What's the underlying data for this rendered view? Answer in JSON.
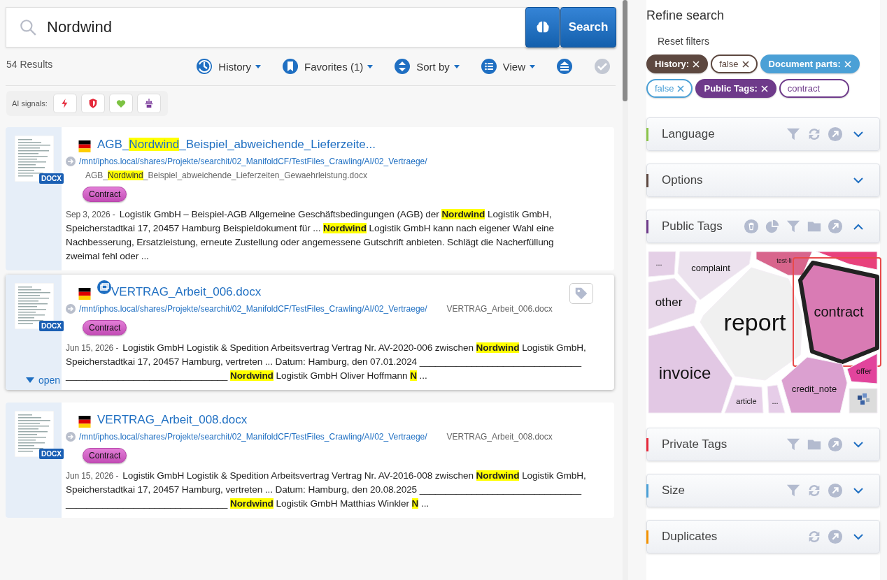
{
  "search": {
    "value": "Nordwind",
    "button": "Search"
  },
  "results_count": "54 Results",
  "toolbar": {
    "menus": [
      {
        "kind": "history",
        "label": "History"
      },
      {
        "kind": "favorites",
        "label": "Favorites (1)"
      },
      {
        "kind": "sort",
        "label": "Sort by"
      },
      {
        "kind": "view",
        "label": "View"
      }
    ],
    "icon_buttons": [
      {
        "kind": "collapse",
        "disabled": false
      },
      {
        "kind": "select",
        "disabled": true
      }
    ]
  },
  "ai_signals": {
    "label": "AI signals:",
    "items": [
      {
        "kind": "bolt"
      },
      {
        "kind": "shield"
      },
      {
        "kind": "heart"
      },
      {
        "kind": "robot"
      }
    ]
  },
  "results": [
    {
      "title": "AGB_**Nordwind**_Beispiel_abweichende_Lieferzeite...",
      "preview_icon": false,
      "tag_button": false,
      "file_type": "DOCX",
      "path": "/mnt/iphos.local/shares/Projekte/searchit/02_ManifoldCF/TestFiles_Crawling/AI/02_Vertraege/",
      "filename": "AGB_**Nordwind**_Beispiel_abweichende_Lieferzeiten_Gewaehrleistung.docx",
      "tag": "Contract",
      "date": "Sep 3, 2026 -",
      "snippet": "Logistik GmbH – Beispiel-AGB Allgemeine Geschäftsbedingungen (AGB) der **Nordwind** Logistik GmbH, Speicherstadtkai 17, 20457 Hamburg Beispieldokument für ... **Nordwind** Logistik GmbH kann nach eigener Wahl eine Nachbesserung, Ersatzleistung, erneute Zustellung oder angemessene Gutschrift anbieten. Schlägt die Nacherfüllung zweimal fehl oder ..."
    },
    {
      "title": "VERTRAG_Arbeit_006.docx",
      "preview_icon": true,
      "tag_button": true,
      "open_toggle": "open",
      "file_type": "DOCX",
      "path": "/mnt/iphos.local/shares/Projekte/searchit/02_ManifoldCF/TestFiles_Crawling/AI/02_Vertraege/",
      "filename": "VERTRAG_Arbeit_006.docx",
      "tag": "Contract",
      "date": "Jun 15, 2026 -",
      "snippet": "Logistik GmbH Logistik & Spedition Arbeitsvertrag Vertrag Nr. AV-2020-006 zwischen **Nordwind** Logistik GmbH, Speicherstadtkai 17, 20457 Hamburg, vertreten ... Datum: Hamburg, den 07.01.2024 _______________________________ _______________________________ **Nordwind** Logistik GmbH Oliver Hoffmann **N** ..."
    },
    {
      "title": "VERTRAG_Arbeit_008.docx",
      "preview_icon": false,
      "tag_button": false,
      "file_type": "DOCX",
      "path": "/mnt/iphos.local/shares/Projekte/searchit/02_ManifoldCF/TestFiles_Crawling/AI/02_Vertraege/",
      "filename": "VERTRAG_Arbeit_008.docx",
      "tag": "Contract",
      "date": "Jun 15, 2026 -",
      "snippet": "Logistik GmbH Logistik & Spedition Arbeitsvertrag Vertrag Nr. AV-2016-008 zwischen **Nordwind** Logistik GmbH, Speicherstadtkai 17, 20457 Hamburg, vertreten ... Datum: Hamburg, den 20.08.2025 _______________________________ _______________________________ **Nordwind** Logistik GmbH Matthias Winkler **N** ..."
    }
  ],
  "sidebar": {
    "title": "Refine search",
    "reset": "Reset filters",
    "chips": [
      {
        "label": "History:",
        "kind": "key",
        "color": "#5d4840",
        "removable": true
      },
      {
        "label": "false",
        "kind": "value",
        "color": "#5d4840",
        "removable": true
      },
      {
        "label": "Document parts:",
        "kind": "key",
        "color": "#4ba0d6",
        "removable": true
      },
      {
        "label": "false",
        "kind": "value",
        "color": "#4ba0d6",
        "removable": true
      },
      {
        "label": "Public Tags:",
        "kind": "key",
        "color": "#6e3a8a",
        "removable": true
      },
      {
        "label": "contract",
        "kind": "value",
        "color": "#6e3a8a",
        "removable": false
      }
    ],
    "facets": [
      {
        "title": "Language",
        "color": "#8bc34a",
        "expanded": false,
        "tools": [
          {
            "kind": "filter"
          },
          {
            "kind": "refresh"
          },
          {
            "kind": "open"
          }
        ]
      },
      {
        "title": "Options",
        "color": "#5d4840",
        "expanded": false
      },
      {
        "title": "Public Tags",
        "color": "#6e3a8a",
        "expanded": true,
        "tools": [
          {
            "kind": "delete"
          },
          {
            "kind": "chart"
          },
          {
            "kind": "filter"
          },
          {
            "kind": "folder"
          },
          {
            "kind": "open"
          }
        ],
        "tag_cloud": [
          {
            "kind": "tag",
            "label": "...",
            "color": "#e4cfe6",
            "selected": false
          },
          {
            "kind": "tag",
            "label": "complaint",
            "color": "#ece2ee",
            "selected": false
          },
          {
            "kind": "tag",
            "label": "test-li",
            "color": "#d8658c",
            "selected": false
          },
          {
            "kind": "tag",
            "color": "#e8417c",
            "selected": false
          },
          {
            "kind": "tag",
            "label": "other",
            "color": "#e8d8ea",
            "selected": false
          },
          {
            "kind": "tag",
            "label": "report",
            "color": "#f0f0f0",
            "selected": false
          },
          {
            "kind": "tag",
            "label": "contract",
            "color": "#d97bb4",
            "selected": true
          },
          {
            "kind": "tag",
            "label": "invoice",
            "color": "#e2c8e4",
            "selected": false
          },
          {
            "kind": "tag",
            "label": "offer",
            "color": "#e2449c",
            "selected": false
          },
          {
            "kind": "tag",
            "label": "credit_note",
            "color": "#dba0d0",
            "selected": false
          },
          {
            "kind": "tag",
            "label": "article",
            "color": "#e8d2ea",
            "selected": false
          },
          {
            "kind": "tag",
            "label": "...",
            "color": "#e6cde8",
            "selected": false
          },
          {
            "kind": "logo",
            "color": "#dcdcdc",
            "selected": false
          }
        ]
      },
      {
        "title": "Private Tags",
        "color": "#e5283a",
        "expanded": false,
        "tools": [
          {
            "kind": "filter"
          },
          {
            "kind": "folder"
          },
          {
            "kind": "open"
          }
        ]
      },
      {
        "title": "Size",
        "color": "#4ba0d6",
        "expanded": false,
        "tools": [
          {
            "kind": "filter"
          },
          {
            "kind": "refresh"
          },
          {
            "kind": "open"
          }
        ]
      },
      {
        "title": "Duplicates",
        "color": "#f39200",
        "expanded": false,
        "tools": [
          {
            "kind": "refresh"
          },
          {
            "kind": "open"
          }
        ]
      }
    ]
  }
}
